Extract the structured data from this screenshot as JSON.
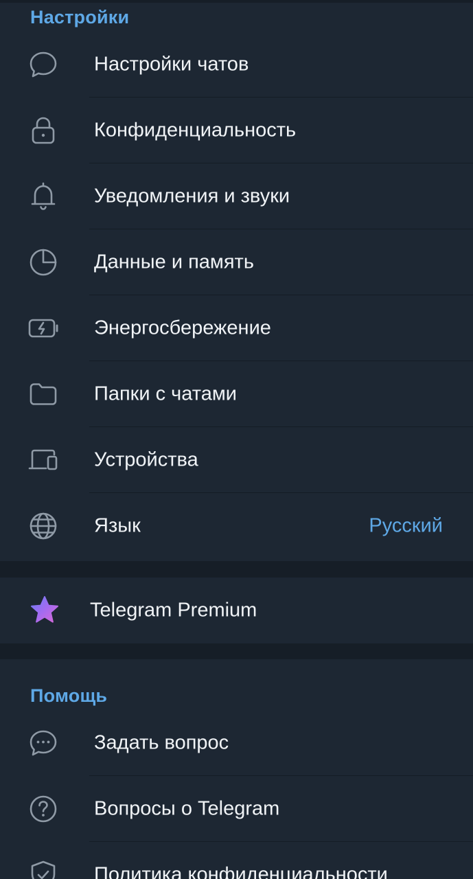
{
  "settings_section": {
    "title": "Настройки",
    "items": [
      {
        "label": "Настройки чатов",
        "icon": "chat-bubble-icon"
      },
      {
        "label": "Конфиденциальность",
        "icon": "lock-icon"
      },
      {
        "label": "Уведомления и звуки",
        "icon": "bell-icon"
      },
      {
        "label": "Данные и память",
        "icon": "pie-chart-icon"
      },
      {
        "label": "Энергосбережение",
        "icon": "battery-icon"
      },
      {
        "label": "Папки с чатами",
        "icon": "folder-icon"
      },
      {
        "label": "Устройства",
        "icon": "devices-icon"
      },
      {
        "label": "Язык",
        "value": "Русский",
        "icon": "globe-icon"
      }
    ]
  },
  "premium": {
    "label": "Telegram Premium",
    "icon": "premium-star-icon"
  },
  "help_section": {
    "title": "Помощь",
    "items": [
      {
        "label": "Задать вопрос",
        "icon": "chat-dots-icon"
      },
      {
        "label": "Вопросы о Telegram",
        "icon": "question-circle-icon"
      },
      {
        "label": "Политика конфиденциальности",
        "icon": "shield-check-icon"
      }
    ]
  },
  "colors": {
    "background": "#1d2733",
    "separator": "#161e27",
    "accent": "#5ea8e6",
    "text": "#f0f3f6",
    "icon": "#8f9aa6"
  }
}
